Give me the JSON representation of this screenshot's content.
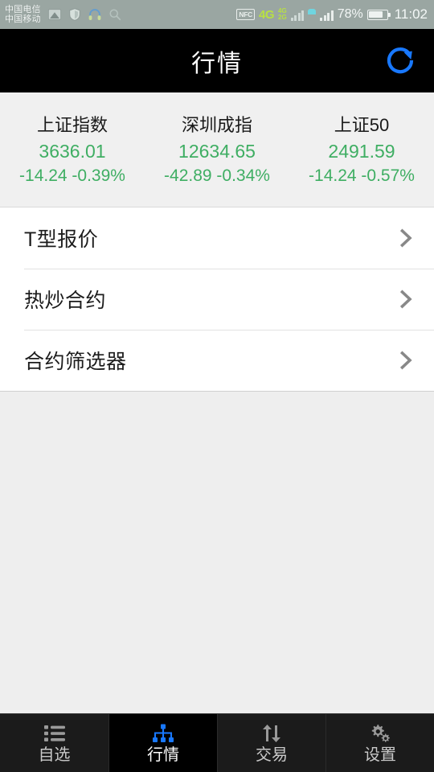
{
  "statusbar": {
    "carrier_line1": "中国电信",
    "carrier_line2": "中国移动",
    "left_icons": [
      "screenshot-icon",
      "shield-icon",
      "headset-icon",
      "search-icon"
    ],
    "nfc_label": "NFC",
    "net_4g_label": "4G",
    "net_4g_small": "4G",
    "net_2g_small": "2G",
    "battery_percent": "78%",
    "clock": "11:02"
  },
  "header": {
    "title": "行情",
    "refresh_icon": "refresh-icon",
    "accent_color": "#1878ff",
    "background": "#000000"
  },
  "indices": {
    "up_color": "#d94a3d",
    "down_color": "#3fae63",
    "items": [
      {
        "name": "上证指数",
        "price": "3636.01",
        "change": "-14.24 -0.39%"
      },
      {
        "name": "深圳成指",
        "price": "12634.65",
        "change": "-42.89 -0.34%"
      },
      {
        "name": "上证50",
        "price": "2491.59",
        "change": "-14.24 -0.57%"
      }
    ]
  },
  "menu": {
    "chevron_icon": "chevron-right-icon",
    "rows": [
      {
        "label": "T型报价"
      },
      {
        "label": "热炒合约"
      },
      {
        "label": "合约筛选器"
      }
    ]
  },
  "tabbar": {
    "active_index": 1,
    "active_color": "#1878ff",
    "items": [
      {
        "label": "自选",
        "icon": "list-icon"
      },
      {
        "label": "行情",
        "icon": "sitemap-icon"
      },
      {
        "label": "交易",
        "icon": "exchange-arrows-icon"
      },
      {
        "label": "设置",
        "icon": "gears-icon"
      }
    ]
  }
}
